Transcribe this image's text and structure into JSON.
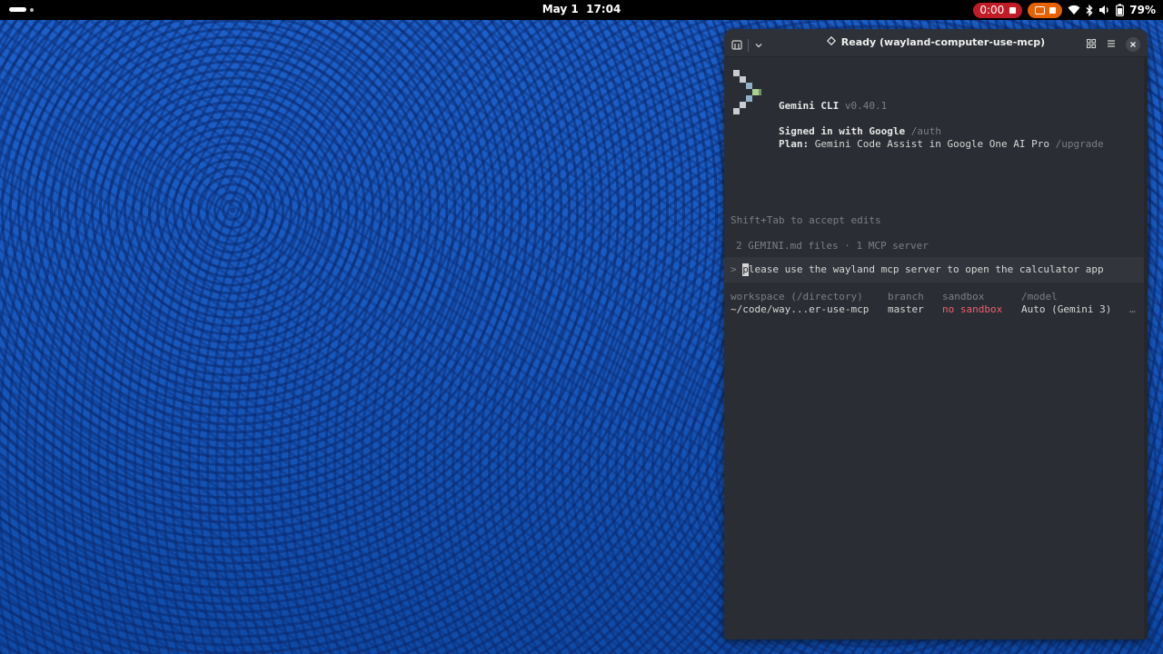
{
  "topbar": {
    "date": "May 1",
    "time": "17:04",
    "recording_time": "0:00",
    "battery": "79%"
  },
  "window": {
    "title": "Ready (wayland-computer-use-mcp)"
  },
  "terminal": {
    "app_name": "Gemini CLI",
    "version": "v0.40.1",
    "signed_in": "Signed in with Google",
    "auth_cmd": "/auth",
    "plan_label": "Plan:",
    "plan_value": "Gemini Code Assist in Google One AI Pro",
    "upgrade_cmd": "/upgrade",
    "hint": "Shift+Tab to accept edits",
    "context": "2 GEMINI.md files · 1 MCP server",
    "prompt_symbol": ">",
    "prompt_first_char": "p",
    "prompt_rest": "lease use the wayland mcp server to open the calculator app",
    "footer": {
      "workspace_label": "workspace (/directory)",
      "workspace_value": "~/code/way...er-use-mcp",
      "branch_label": "branch",
      "branch_value": "master",
      "sandbox_label": "sandbox",
      "sandbox_value": "no sandbox",
      "model_label": "/model",
      "model_value": "Auto (Gemini 3)",
      "ellipsis": "…"
    }
  },
  "colors": {
    "accent_red": "#c01c28",
    "accent_orange": "#e66100",
    "sandbox_red": "#ef5f6f",
    "logo_green": "#a9d18e",
    "logo_gray": "#c8ccd2"
  }
}
